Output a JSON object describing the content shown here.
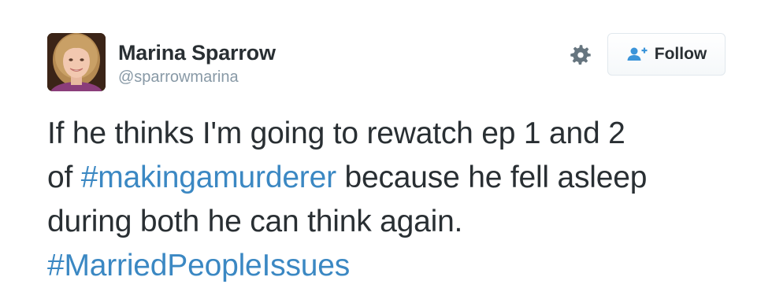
{
  "user": {
    "name": "Marina Sparrow",
    "handle": "@sparrowmarina"
  },
  "actions": {
    "follow_label": "Follow",
    "settings_icon": "gear-icon",
    "follow_icon": "add-user-icon"
  },
  "tweet": {
    "line1": "If he thinks I'm going to rewatch ep 1 and 2",
    "line2_prefix": "of ",
    "hashtag1": "#makingamurderer",
    "line2_suffix": " because he fell asleep",
    "line3": "during both he can think again.",
    "hashtag2": "#MarriedPeopleIssues"
  },
  "colors": {
    "hashtag": "#3b88c3",
    "text": "#292f33",
    "handle": "#8899a6",
    "icon": "#66757f"
  }
}
